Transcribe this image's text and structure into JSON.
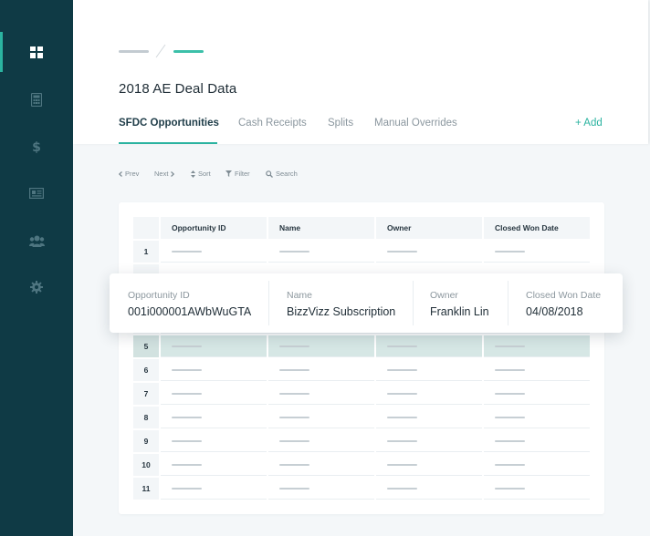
{
  "sidebar": {
    "items": [
      {
        "name": "dashboard-icon",
        "active": true
      },
      {
        "name": "calculator-icon",
        "active": false
      },
      {
        "name": "dollar-icon",
        "active": false
      },
      {
        "name": "newspaper-icon",
        "active": false
      },
      {
        "name": "users-icon",
        "active": false
      },
      {
        "name": "gear-icon",
        "active": false
      }
    ]
  },
  "header": {
    "title": "2018 AE Deal Data",
    "tabs": [
      {
        "label": "SFDC Opportunities",
        "active": true
      },
      {
        "label": "Cash Receipts",
        "active": false
      },
      {
        "label": "Splits",
        "active": false
      },
      {
        "label": "Manual Overrides",
        "active": false
      }
    ],
    "add_label": "+ Add"
  },
  "toolbar": {
    "prev": "Prev",
    "next": "Next",
    "sort": "Sort",
    "filter": "Filter",
    "search": "Search"
  },
  "table": {
    "columns": [
      "Opportunity ID",
      "Name",
      "Owner",
      "Closed Won Date"
    ],
    "row_numbers": [
      "1",
      "5",
      "6",
      "7",
      "8",
      "9",
      "10",
      "11"
    ],
    "highlighted_row": "5"
  },
  "popover": {
    "fields": [
      {
        "label": "Opportunity ID",
        "value": "001i000001AWbWuGTA"
      },
      {
        "label": "Name",
        "value": "BizzVizz Subscription"
      },
      {
        "label": "Owner",
        "value": "Franklin Lin"
      },
      {
        "label": "Closed Won Date",
        "value": "04/08/2018"
      }
    ]
  },
  "colors": {
    "sidebar": "#0f3a45",
    "accent": "#2bb3a0",
    "highlight_row": "#d6e7e5"
  }
}
